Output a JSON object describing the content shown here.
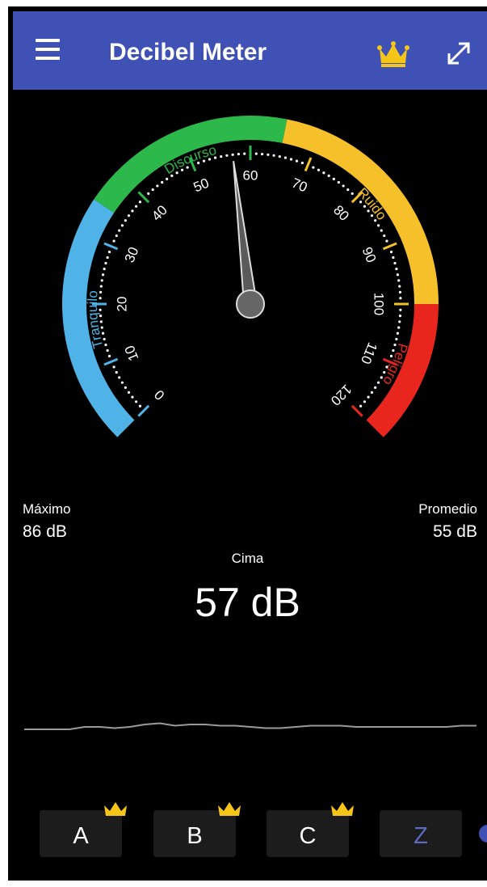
{
  "app_bar": {
    "title": "Decibel Meter",
    "menu_icon": "hamburger-menu-icon",
    "premium_icon": "crown-icon",
    "fullscreen_icon": "expand-icon",
    "background_color": "#3f51b5",
    "crown_color": "#f5c518"
  },
  "gauge": {
    "min": 0,
    "max": 120,
    "current_value": 57,
    "tick_labels": [
      "0",
      "10",
      "20",
      "30",
      "40",
      "50",
      "60",
      "70",
      "80",
      "90",
      "100",
      "110",
      "120"
    ],
    "zones": [
      {
        "label": "Tranquilo",
        "from": 0,
        "to": 35,
        "color": "#4fb3e8"
      },
      {
        "label": "Discurso",
        "from": 35,
        "to": 65,
        "color": "#2db84b"
      },
      {
        "label": "Ruido",
        "from": 65,
        "to": 100,
        "color": "#f5c02a"
      },
      {
        "label": "Peligro",
        "from": 100,
        "to": 120,
        "color": "#e8261d"
      }
    ]
  },
  "stats": {
    "max_label": "Máximo",
    "max_value": "86 dB",
    "avg_label": "Promedio",
    "avg_value": "55 dB",
    "peak_label": "Cima",
    "peak_value": "57 dB"
  },
  "history": [
    44,
    44,
    44,
    44,
    46,
    46,
    45,
    46,
    48,
    49,
    47,
    48,
    48,
    47,
    47,
    46,
    45,
    45,
    46,
    47,
    47,
    47,
    46,
    46,
    46,
    46,
    46,
    46,
    46,
    47,
    47
  ],
  "weighting": {
    "buttons": [
      {
        "label": "A",
        "premium": true,
        "selected": false
      },
      {
        "label": "B",
        "premium": true,
        "selected": false
      },
      {
        "label": "C",
        "premium": true,
        "selected": false
      },
      {
        "label": "Z",
        "premium": false,
        "selected": true
      }
    ],
    "selected_color": "#5c6bc0"
  }
}
